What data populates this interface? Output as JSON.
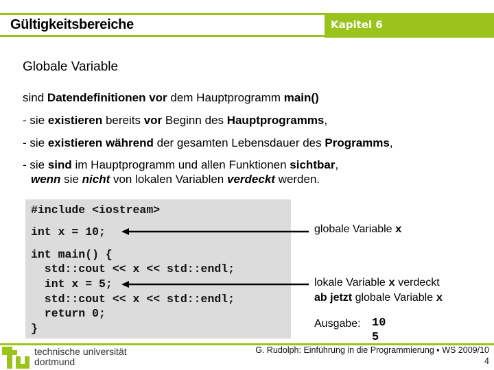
{
  "header": {
    "title": "Gültigkeitsbereiche",
    "chapter": "Kapitel 6",
    "accent_color": "#9ac31c"
  },
  "slide": {
    "heading": "Globale Variable",
    "line1": {
      "a": "sind ",
      "b": "Datendefinitionen vor",
      "c": " dem Hauptprogramm ",
      "d": "main()"
    },
    "bullet1": {
      "a": "- sie ",
      "b": "existieren",
      "c": " bereits ",
      "d": "vor",
      "e": " Beginn des ",
      "f": "Hauptprogramms",
      "g": ","
    },
    "bullet2": {
      "a": "- sie ",
      "b": "existieren während",
      "c": " der gesamten Lebensdauer des ",
      "d": "Programms",
      "e": ","
    },
    "bullet3": {
      "a": "- sie ",
      "b": "sind",
      "c": " im Hauptprogramm und allen Funktionen ",
      "d": "sichtbar",
      "e": ","
    },
    "bullet3b": {
      "a": "wenn",
      "b": " sie ",
      "c": "nicht",
      "d": " von lokalen Variablen ",
      "e": "verdeckt",
      "f": " werden."
    }
  },
  "code": {
    "lines": [
      "#include <iostream>",
      "int x = 10;",
      "int main() {",
      "  std::cout << x << std::endl;",
      "  int x = 5;",
      "  std::cout << x << std::endl;",
      "  return 0;",
      "}"
    ]
  },
  "annotations": {
    "global": {
      "text": "globale Variable ",
      "var": "x"
    },
    "local_line1": {
      "text": "lokale Variable ",
      "var": "x",
      "rest": " verdeckt"
    },
    "local_line2": {
      "bold": "ab jetzt",
      "text": " globale Variable ",
      "var": "x"
    },
    "output_label": "Ausgabe:",
    "output_values": [
      "10",
      "5"
    ]
  },
  "footer": {
    "logo_text": "tu",
    "university_line1": "technische universität",
    "university_line2": "dortmund",
    "credit": "G. Rudolph: Einführung in die Programmierung ▪ WS 2009/10",
    "page_number": "4"
  }
}
